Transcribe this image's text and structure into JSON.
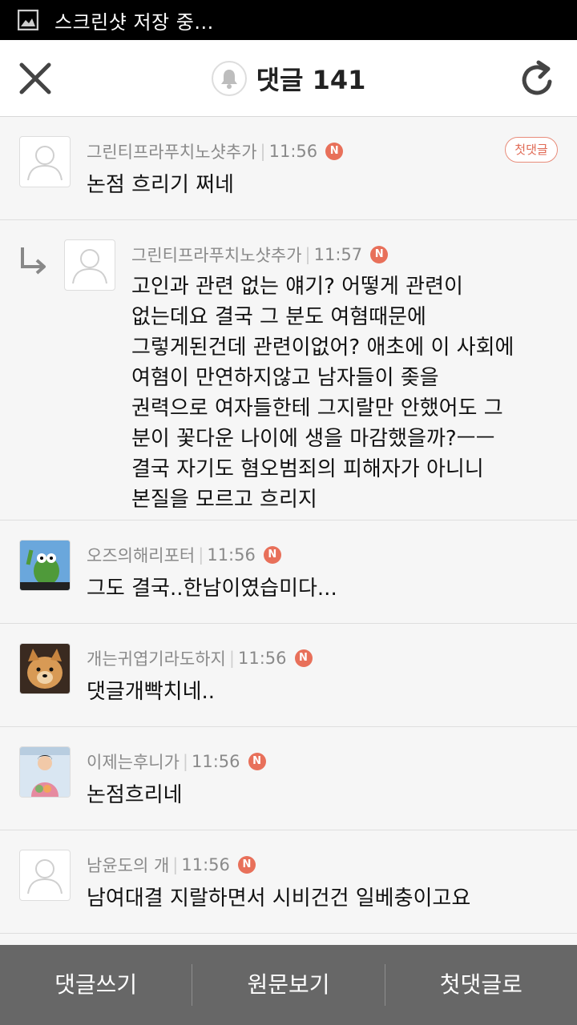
{
  "status_bar": {
    "text": "스크린샷 저장 중..."
  },
  "header": {
    "title": "댓글 141",
    "icons": [
      "close-icon",
      "bell-icon",
      "refresh-icon"
    ]
  },
  "comments": [
    {
      "author": "그린티프라푸치노샷추가",
      "time": "11:56",
      "new_badge": "N",
      "first_badge": "첫댓글",
      "text": "논점 흐리기 쩌네",
      "reply": false,
      "avatar": "default"
    },
    {
      "author": "그린티프라푸치노샷추가",
      "time": "11:57",
      "new_badge": "N",
      "text": "고인과 관련 없는 얘기? 어떻게 관련이\n없는데요 결국 그 분도 여혐때문에\n그렇게된건데 관련이없어? 애초에 이 사회에\n여혐이 만연하지않고 남자들이 좆을\n권력으로 여자들한테 그지랄만 안했어도 그\n분이 꽃다운 나이에 생을 마감했을까?ㅡㅡ\n결국 자기도 혐오범죄의 피해자가 아니니\n본질을 모르고 흐리지",
      "reply": true,
      "avatar": "default"
    },
    {
      "author": "오즈의해리포터",
      "time": "11:56",
      "new_badge": "N",
      "text": "그도 결국..한남이였습미다...",
      "reply": false,
      "avatar": "frog"
    },
    {
      "author": "개는귀엽기라도하지",
      "time": "11:56",
      "new_badge": "N",
      "text": "댓글개빡치네..",
      "reply": false,
      "avatar": "dog"
    },
    {
      "author": "이제는후니가",
      "time": "11:56",
      "new_badge": "N",
      "text": "논점흐리네",
      "reply": false,
      "avatar": "person"
    },
    {
      "author": "남윤도의 개",
      "time": "11:56",
      "new_badge": "N",
      "text": "남여대결 지랄하면서 시비건건 일베충이고요",
      "reply": false,
      "avatar": "default"
    }
  ],
  "bottom_bar": {
    "write": "댓글쓰기",
    "original": "원문보기",
    "first": "첫댓글로"
  },
  "colors": {
    "badge": "#e8705a",
    "bottom_bar": "#676767",
    "background": "#f6f6f6"
  }
}
